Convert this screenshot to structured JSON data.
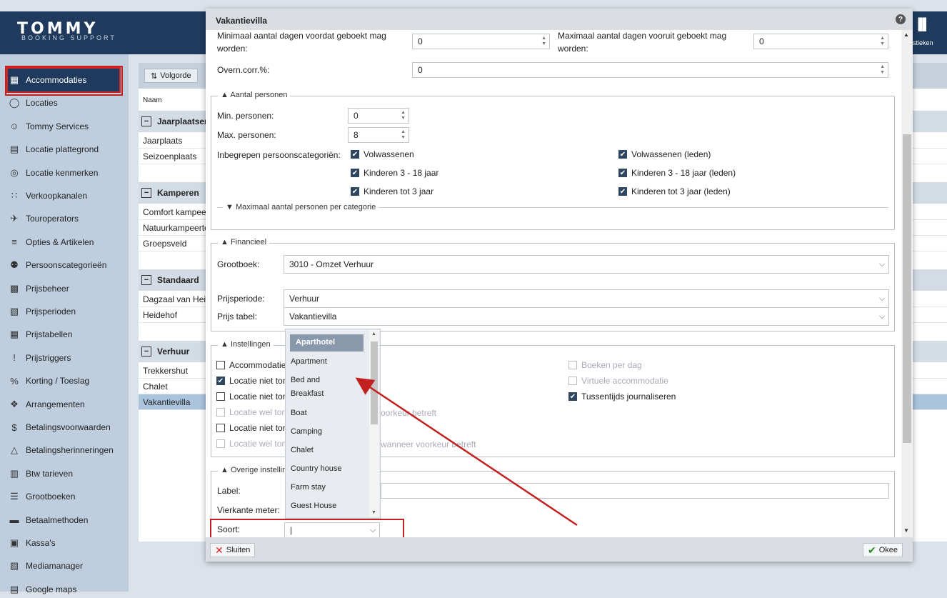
{
  "app": {
    "logo": "TOMMY",
    "logo_sub": "BOOKING SUPPORT",
    "stats_label": "istieken",
    "stats_icon": "bar-chart-icon"
  },
  "sidebar": {
    "items": [
      {
        "label": "Accommodaties",
        "icon": "building-icon"
      },
      {
        "label": "Locaties",
        "icon": "map-pin-icon"
      },
      {
        "label": "Tommy Services",
        "icon": "person-card-icon"
      },
      {
        "label": "Locatie plattegrond",
        "icon": "map-icon"
      },
      {
        "label": "Locatie kenmerken",
        "icon": "location-marker-icon"
      },
      {
        "label": "Verkoopkanalen",
        "icon": "network-icon"
      },
      {
        "label": "Touroperators",
        "icon": "plane-icon"
      },
      {
        "label": "Opties & Artikelen",
        "icon": "stack-plus-icon"
      },
      {
        "label": "Persoonscategorieën",
        "icon": "people-icon"
      },
      {
        "label": "Prijsbeheer",
        "icon": "calculator-icon"
      },
      {
        "label": "Prijsperioden",
        "icon": "calendar-edit-icon"
      },
      {
        "label": "Prijstabellen",
        "icon": "table-icon"
      },
      {
        "label": "Prijstriggers",
        "icon": "exclamation-icon"
      },
      {
        "label": "Korting / Toeslag",
        "icon": "percent-icon"
      },
      {
        "label": "Arrangementen",
        "icon": "gift-icon"
      },
      {
        "label": "Betalingsvoorwaarden",
        "icon": "dollar-icon"
      },
      {
        "label": "Betalingsherinneringen",
        "icon": "alarm-icon"
      },
      {
        "label": "Btw tarieven",
        "icon": "building-tax-icon"
      },
      {
        "label": "Grootboeken",
        "icon": "list-icon"
      },
      {
        "label": "Betaalmethoden",
        "icon": "card-icon"
      },
      {
        "label": "Kassa's",
        "icon": "register-icon"
      },
      {
        "label": "Mediamanager",
        "icon": "media-icon"
      },
      {
        "label": "Google maps",
        "icon": "map-icon"
      }
    ]
  },
  "list": {
    "sort_label": "Volgorde",
    "column_name": "Naam",
    "groups": [
      {
        "title": "Jaarplaatsen",
        "items": [
          "Jaarplaats",
          "Seizoenplaats"
        ]
      },
      {
        "title": "Kamperen",
        "items": [
          "Comfort kampeerplaats",
          "Natuurkampeerterrein",
          "Groepsveld"
        ]
      },
      {
        "title": "Standaard",
        "items": [
          "Dagzaal van Heide",
          "Heidehof"
        ]
      },
      {
        "title": "Verhuur",
        "items": [
          "Trekkershut",
          "Chalet",
          "Vakantievilla"
        ]
      }
    ]
  },
  "modal": {
    "title": "Vakantievilla",
    "help_icon": "?",
    "min_days_label": "Minimaal aantal dagen voordat geboekt mag worden:",
    "min_days_value": "0",
    "max_days_label": "Maximaal aantal dagen vooruit geboekt mag worden:",
    "max_days_value": "0",
    "overn_label": "Overn.corr.%:",
    "overn_value": "0",
    "persons": {
      "legend": "Aantal personen",
      "min_label": "Min. personen:",
      "min_value": "0",
      "max_label": "Max. personen:",
      "max_value": "8",
      "incl_label": "Inbegrepen persoonscategoriën:",
      "categories": [
        "Volwassenen",
        "Kinderen 3 - 18 jaar",
        "Kinderen tot 3 jaar"
      ],
      "categories_leden": [
        "Volwassenen (leden)",
        "Kinderen 3 - 18 jaar (leden)",
        "Kinderen tot 3 jaar (leden)"
      ],
      "sub_legend": "Maximaal aantal personen per categorie"
    },
    "financial": {
      "legend": "Financieel",
      "grootboek_label": "Grootboek:",
      "grootboek_value": "3010 - Omzet Verhuur",
      "prijsperiode_label": "Prijsperiode:",
      "prijsperiode_value": "Verhuur",
      "prijstabel_label": "Prijs tabel:",
      "prijstabel_value": "Vakantievilla"
    },
    "settings": {
      "legend": "Instellingen",
      "left": [
        {
          "label": "Accommodatie",
          "checked": false,
          "disabled": false
        },
        {
          "label": "Locatie niet ton",
          "checked": true,
          "disabled": false
        },
        {
          "label": "Locatie niet ton",
          "checked": false,
          "disabled": false
        },
        {
          "label": "Locatie wel ton",
          "checked": false,
          "disabled": true,
          "tail": "oorkeur betreft"
        },
        {
          "label": "Locatie niet ton",
          "checked": false,
          "disabled": false
        },
        {
          "label": "Locatie wel ton",
          "checked": false,
          "disabled": true,
          "tail": "wanneer voorkeur betreft"
        }
      ],
      "right": [
        {
          "label": "Boeken per dag",
          "checked": false,
          "disabled": true
        },
        {
          "label": "Virtuele accommodatie",
          "checked": false,
          "disabled": true
        },
        {
          "label": "Tussentijds journaliseren",
          "checked": true,
          "disabled": false
        }
      ]
    },
    "other": {
      "legend": "Overige instellin",
      "label_label": "Label:",
      "sqm_label": "Vierkante meter:",
      "soort_label": "Soort:",
      "soort_value": "|"
    },
    "dropdown": {
      "selected": "Aparthotel",
      "options": [
        "Apartment",
        "Bed and",
        "Breakfast",
        "Boat",
        "Camping",
        "Chalet",
        "Country house",
        "Farm stay",
        "Guest House"
      ]
    },
    "footer": {
      "close_label": "Sluiten",
      "ok_label": "Okee"
    }
  },
  "colors": {
    "header": "#1f3a5d",
    "sidebar": "#bfcedf",
    "annotation": "#c32020",
    "selected_row": "#aac4de"
  }
}
